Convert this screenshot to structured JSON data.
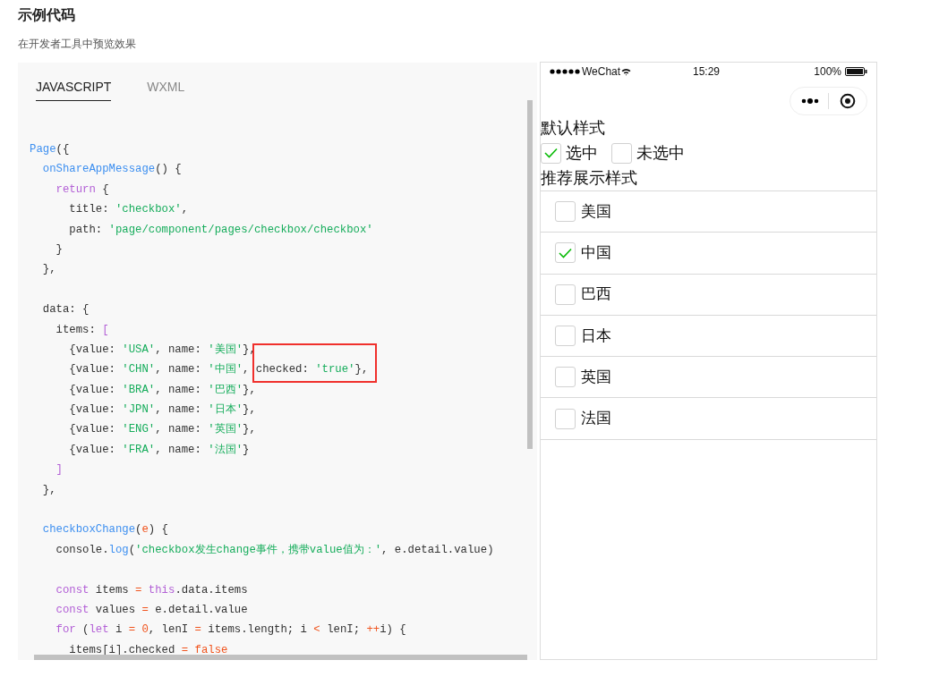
{
  "heading": "示例代码",
  "subheading": "在开发者工具中预览效果",
  "code_panel": {
    "tabs": [
      {
        "label": "JAVASCRIPT",
        "selected": true
      },
      {
        "label": "WXML",
        "selected": false
      }
    ],
    "lines": [
      {
        "kind": "code",
        "tokens": [
          {
            "t": "Page",
            "kind": "fn"
          },
          {
            "t": "({",
            "kind": "p"
          }
        ]
      },
      {
        "kind": "code",
        "tokens": [
          {
            "t": "  onShareAppMessage",
            "kind": "fn"
          },
          {
            "t": "() {",
            "kind": "p"
          }
        ]
      },
      {
        "kind": "code",
        "tokens": [
          {
            "t": "    return",
            "kind": "kw"
          },
          {
            "t": " {",
            "kind": "p"
          }
        ]
      },
      {
        "kind": "code",
        "tokens": [
          {
            "t": "      title: ",
            "kind": "p"
          },
          {
            "t": "'checkbox'",
            "kind": "str"
          },
          {
            "t": ",",
            "kind": "p"
          }
        ]
      },
      {
        "kind": "code",
        "tokens": [
          {
            "t": "      path: ",
            "kind": "p"
          },
          {
            "t": "'page/component/pages/checkbox/checkbox'",
            "kind": "str"
          }
        ]
      },
      {
        "kind": "code",
        "tokens": [
          {
            "t": "    }",
            "kind": "p"
          }
        ]
      },
      {
        "kind": "code",
        "tokens": [
          {
            "t": "  },",
            "kind": "p"
          }
        ]
      },
      {
        "kind": "blank"
      },
      {
        "kind": "code",
        "tokens": [
          {
            "t": "  data: {",
            "kind": "p"
          }
        ]
      },
      {
        "kind": "code",
        "tokens": [
          {
            "t": "    items: ",
            "kind": "p"
          },
          {
            "t": "[",
            "kind": "kw"
          }
        ]
      },
      {
        "kind": "code",
        "tokens": [
          {
            "t": "      {value: ",
            "kind": "p"
          },
          {
            "t": "'USA'",
            "kind": "str"
          },
          {
            "t": ", name: ",
            "kind": "p"
          },
          {
            "t": "'美国'",
            "kind": "str"
          },
          {
            "t": "},",
            "kind": "p"
          }
        ]
      },
      {
        "kind": "code",
        "tokens": [
          {
            "t": "      {value: ",
            "kind": "p"
          },
          {
            "t": "'CHN'",
            "kind": "str"
          },
          {
            "t": ", name: ",
            "kind": "p"
          },
          {
            "t": "'中国'",
            "kind": "str"
          },
          {
            "t": ", ",
            "kind": "p"
          }
        ],
        "boxed": [
          {
            "t": "checked: ",
            "kind": "p"
          },
          {
            "t": "'true'",
            "kind": "str"
          },
          {
            "t": "},",
            "kind": "p"
          }
        ]
      },
      {
        "kind": "code",
        "tokens": [
          {
            "t": "      {value: ",
            "kind": "p"
          },
          {
            "t": "'BRA'",
            "kind": "str"
          },
          {
            "t": ", name: ",
            "kind": "p"
          },
          {
            "t": "'巴西'",
            "kind": "str"
          },
          {
            "t": "},",
            "kind": "p"
          }
        ]
      },
      {
        "kind": "code",
        "tokens": [
          {
            "t": "      {value: ",
            "kind": "p"
          },
          {
            "t": "'JPN'",
            "kind": "str"
          },
          {
            "t": ", name: ",
            "kind": "p"
          },
          {
            "t": "'日本'",
            "kind": "str"
          },
          {
            "t": "},",
            "kind": "p"
          }
        ]
      },
      {
        "kind": "code",
        "tokens": [
          {
            "t": "      {value: ",
            "kind": "p"
          },
          {
            "t": "'ENG'",
            "kind": "str"
          },
          {
            "t": ", name: ",
            "kind": "p"
          },
          {
            "t": "'英国'",
            "kind": "str"
          },
          {
            "t": "},",
            "kind": "p"
          }
        ]
      },
      {
        "kind": "code",
        "tokens": [
          {
            "t": "      {value: ",
            "kind": "p"
          },
          {
            "t": "'FRA'",
            "kind": "str"
          },
          {
            "t": ", name: ",
            "kind": "p"
          },
          {
            "t": "'法国'",
            "kind": "str"
          },
          {
            "t": "}",
            "kind": "p"
          }
        ]
      },
      {
        "kind": "code",
        "tokens": [
          {
            "t": "    ]",
            "kind": "kw"
          }
        ]
      },
      {
        "kind": "code",
        "tokens": [
          {
            "t": "  },",
            "kind": "p"
          }
        ]
      },
      {
        "kind": "blank"
      },
      {
        "kind": "code",
        "tokens": [
          {
            "t": "  checkboxChange",
            "kind": "fn"
          },
          {
            "t": "(",
            "kind": "p"
          },
          {
            "t": "e",
            "kind": "op"
          },
          {
            "t": ") {",
            "kind": "p"
          }
        ]
      },
      {
        "kind": "code",
        "tokens": [
          {
            "t": "    console.",
            "kind": "p"
          },
          {
            "t": "log",
            "kind": "fn"
          },
          {
            "t": "(",
            "kind": "p"
          },
          {
            "t": "'checkbox发生change事件，携带value值为：'",
            "kind": "str"
          },
          {
            "t": ", e.detail.value)",
            "kind": "p"
          }
        ]
      },
      {
        "kind": "blank"
      },
      {
        "kind": "code",
        "tokens": [
          {
            "t": "    const",
            "kind": "kw"
          },
          {
            "t": " items ",
            "kind": "p"
          },
          {
            "t": "=",
            "kind": "op"
          },
          {
            "t": " this",
            "kind": "kw"
          },
          {
            "t": ".data.items",
            "kind": "p"
          }
        ]
      },
      {
        "kind": "code",
        "tokens": [
          {
            "t": "    const",
            "kind": "kw"
          },
          {
            "t": " values ",
            "kind": "p"
          },
          {
            "t": "=",
            "kind": "op"
          },
          {
            "t": " e.detail.value",
            "kind": "p"
          }
        ]
      },
      {
        "kind": "code",
        "tokens": [
          {
            "t": "    for",
            "kind": "kw"
          },
          {
            "t": " (",
            "kind": "p"
          },
          {
            "t": "let",
            "kind": "kw"
          },
          {
            "t": " i ",
            "kind": "p"
          },
          {
            "t": "=",
            "kind": "op"
          },
          {
            "t": " 0",
            "kind": "op"
          },
          {
            "t": ", lenI ",
            "kind": "p"
          },
          {
            "t": "=",
            "kind": "op"
          },
          {
            "t": " items.length; i ",
            "kind": "p"
          },
          {
            "t": "<",
            "kind": "op"
          },
          {
            "t": " lenI; ",
            "kind": "p"
          },
          {
            "t": "++",
            "kind": "op"
          },
          {
            "t": "i) {",
            "kind": "p"
          }
        ]
      },
      {
        "kind": "code",
        "tokens": [
          {
            "t": "      items[i].checked ",
            "kind": "p"
          },
          {
            "t": "=",
            "kind": "op"
          },
          {
            "t": " false",
            "kind": "op"
          }
        ]
      }
    ]
  },
  "preview": {
    "status_bar": {
      "carrier": "WeChat",
      "time": "15:29",
      "battery": "100%"
    },
    "default_title": "默认样式",
    "default_options": [
      {
        "label": "选中",
        "checked": true
      },
      {
        "label": "未选中",
        "checked": false
      }
    ],
    "list_title": "推荐展示样式",
    "list_items": [
      {
        "label": "美国",
        "checked": false
      },
      {
        "label": "中国",
        "checked": true
      },
      {
        "label": "巴西",
        "checked": false
      },
      {
        "label": "日本",
        "checked": false
      },
      {
        "label": "英国",
        "checked": false
      },
      {
        "label": "法国",
        "checked": false
      }
    ]
  }
}
